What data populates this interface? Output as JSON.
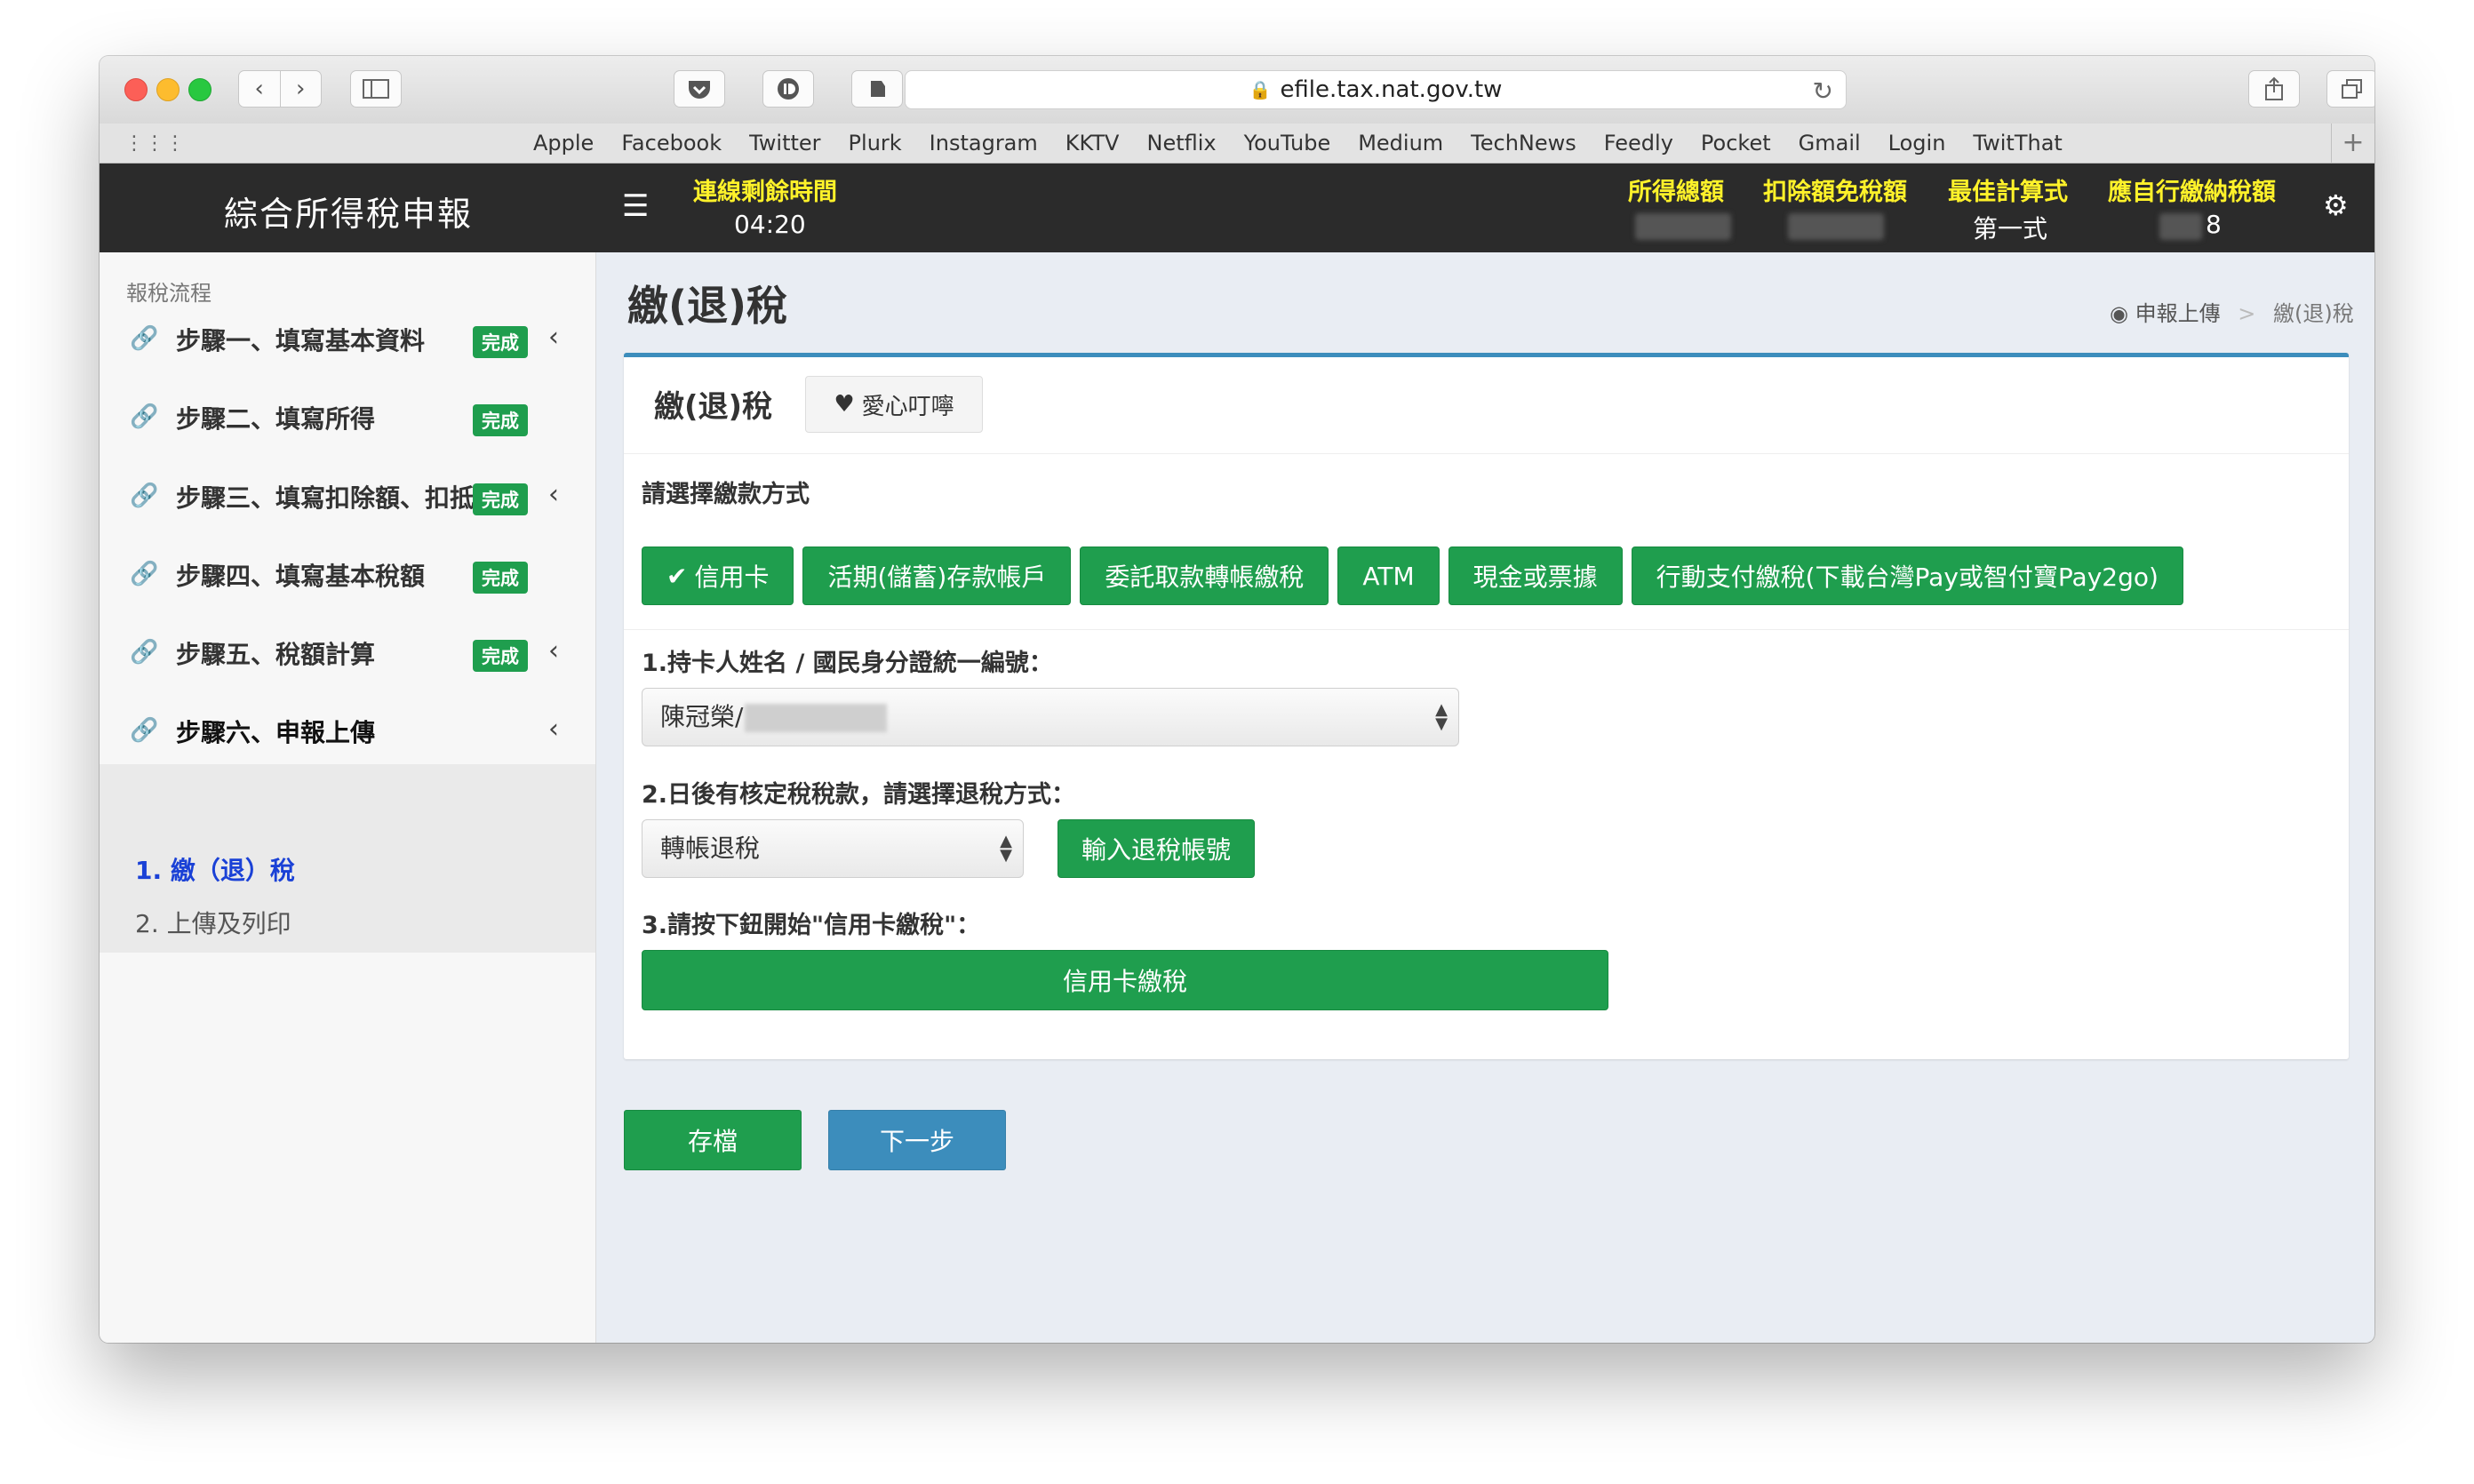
{
  "browser": {
    "url": "efile.tax.nat.gov.tw",
    "favorites": [
      "Apple",
      "Facebook",
      "Twitter",
      "Plurk",
      "Instagram",
      "KKTV",
      "Netflix",
      "YouTube",
      "Medium",
      "TechNews",
      "Feedly",
      "Pocket",
      "Gmail",
      "Login",
      "TwitThat"
    ]
  },
  "header": {
    "app_title": "綜合所得稅申報",
    "session_label": "連線剩餘時間",
    "session_time": "04:20",
    "income_total_label": "所得總額",
    "deduction_label": "扣除額免稅額",
    "best_formula_label": "最佳計算式",
    "best_formula_value": "第一式",
    "tax_payable_label": "應自行繳納稅額",
    "tax_payable_value": "8"
  },
  "sidebar": {
    "title": "報稅流程",
    "steps": [
      {
        "label": "步驟一、填寫基本資料",
        "badge": "完成"
      },
      {
        "label": "步驟二、填寫所得",
        "badge": "完成"
      },
      {
        "label": "步驟三、填寫扣除額、扣抵",
        "badge": "完成"
      },
      {
        "label": "步驟四、填寫基本稅額",
        "badge": "完成"
      },
      {
        "label": "步驟五、稅額計算",
        "badge": "完成"
      },
      {
        "label": "步驟六、申報上傳",
        "badge": ""
      }
    ],
    "substeps": [
      "1. 繳（退）稅",
      "2. 上傳及列印"
    ]
  },
  "main": {
    "page_title": "繳(退)稅",
    "breadcrumb": {
      "parent": "申報上傳",
      "current": "繳(退)稅"
    },
    "panel_title": "繳(退)稅",
    "reminder_label": "愛心叮嚀",
    "choose_payment_label": "請選擇繳款方式",
    "payment_methods": [
      "信用卡",
      "活期(儲蓄)存款帳戶",
      "委託取款轉帳繳稅",
      "ATM",
      "現金或票據",
      "行動支付繳稅(下載台灣Pay或智付寶Pay2go)"
    ],
    "q1_label": "1.持卡人姓名 / 國民身分證統一編號：",
    "cardholder_value": "陳冠榮/",
    "q2_label": "2.日後有核定稅稅款，請選擇退稅方式：",
    "refund_method_value": "轉帳退稅",
    "refund_account_button": "輸入退稅帳號",
    "q3_label": "3.請按下鈕開始\"信用卡繳稅\"：",
    "credit_card_pay_button": "信用卡繳稅",
    "save_button": "存檔",
    "next_button": "下一步"
  },
  "colors": {
    "green": "#1f9e4e",
    "blue": "#3c8dbc",
    "header_bg": "#2b2b2b",
    "header_label": "#fff22a",
    "active_link": "#1a41d6"
  }
}
